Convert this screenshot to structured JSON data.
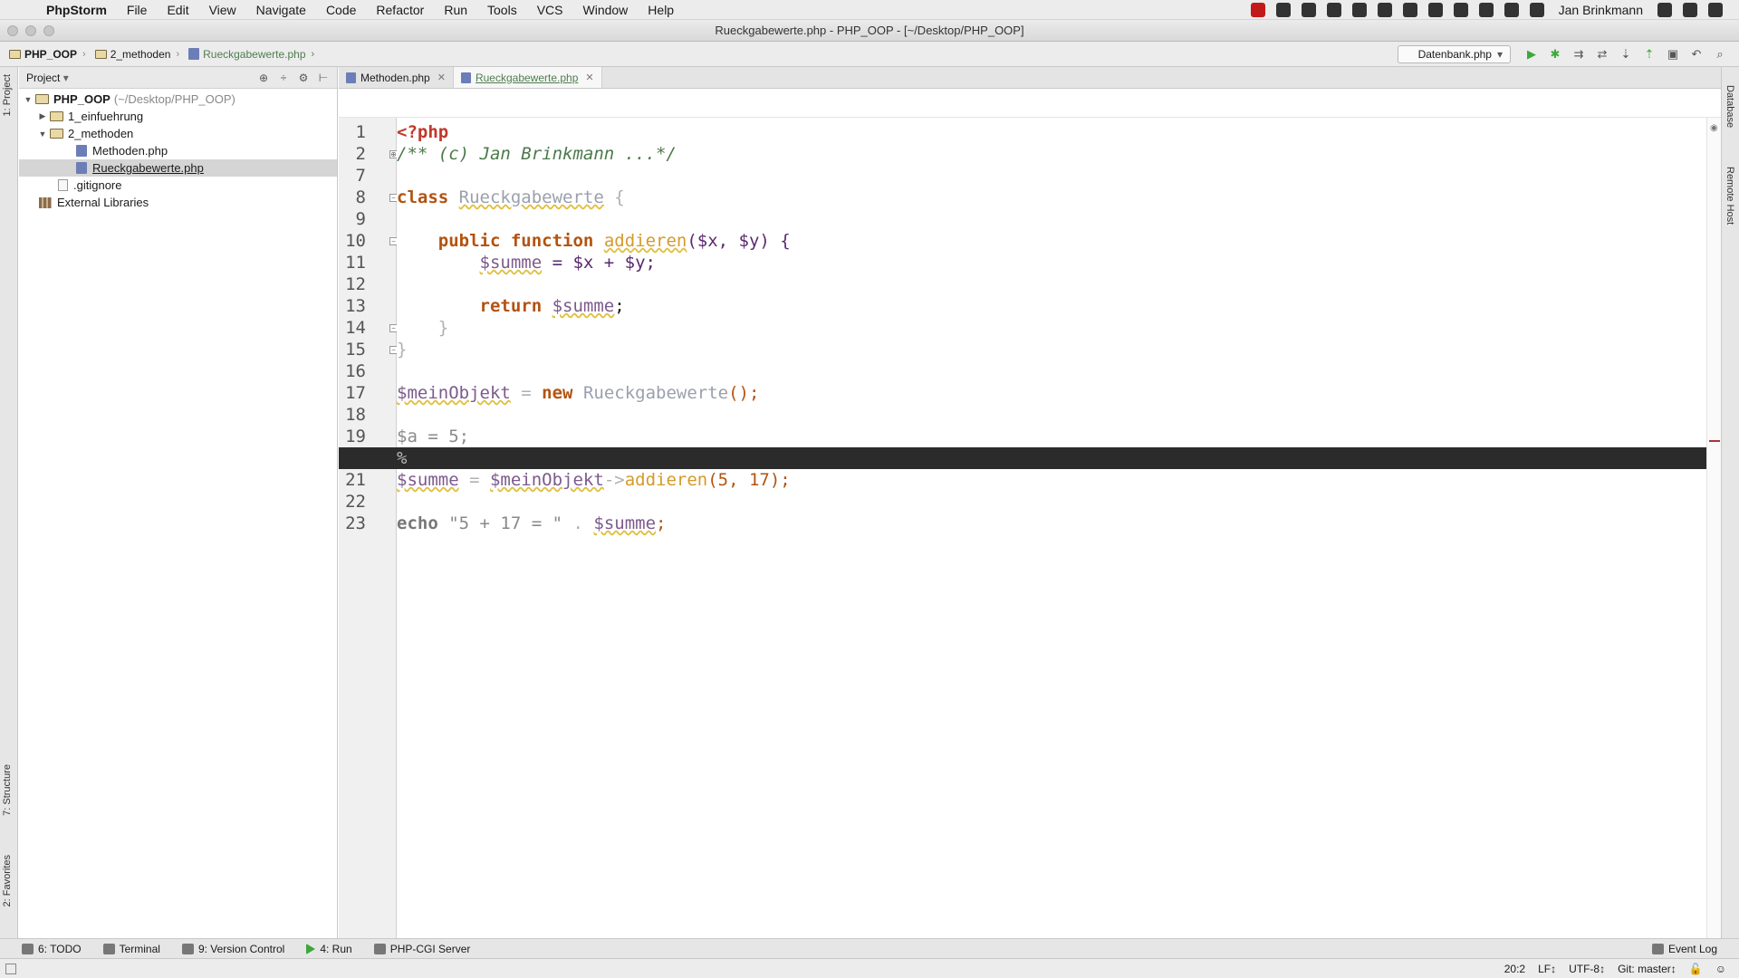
{
  "menubar": {
    "app_name": "PhpStorm",
    "items": [
      "File",
      "Edit",
      "View",
      "Navigate",
      "Code",
      "Refactor",
      "Run",
      "Tools",
      "VCS",
      "Window",
      "Help"
    ],
    "user": "Jan Brinkmann"
  },
  "window": {
    "title": "Rueckgabewerte.php - PHP_OOP - [~/Desktop/PHP_OOP]"
  },
  "breadcrumb": {
    "items": [
      "PHP_OOP",
      "2_methoden",
      "Rueckgabewerte.php"
    ]
  },
  "toolbar": {
    "run_config": "Datenbank.php"
  },
  "left_stripe": {
    "project_tab": "1: Project",
    "structure_tab": "7: Structure",
    "favorites_tab": "2: Favorites"
  },
  "right_stripe": {
    "database_tab": "Database",
    "remote_host_tab": "Remote Host"
  },
  "project_panel": {
    "title": "Project",
    "tree": [
      {
        "label": "PHP_OOP",
        "suffix": "(~/Desktop/PHP_OOP)"
      },
      {
        "label": "1_einfuehrung"
      },
      {
        "label": "2_methoden"
      },
      {
        "label": "Methoden.php"
      },
      {
        "label": "Rueckgabewerte.php"
      },
      {
        "label": ".gitignore"
      },
      {
        "label": "External Libraries"
      }
    ]
  },
  "editor": {
    "tabs": [
      {
        "label": "Methoden.php"
      },
      {
        "label": "Rueckgabewerte.php"
      }
    ],
    "line_numbers": [
      "1",
      "2",
      "7",
      "8",
      "9",
      "10",
      "11",
      "12",
      "13",
      "14",
      "15",
      "16",
      "17",
      "18",
      "19",
      "20",
      "21",
      "22",
      "23"
    ],
    "code": {
      "l1": "<?php",
      "l2": "/** (c) Jan Brinkmann ...*/",
      "l8_kw": "class",
      "l8_cls": "Rueckgabewerte",
      "l8_brace": "{",
      "l10_kw": "public function",
      "l10_fn": "addieren",
      "l10_params": "($x, $y) {",
      "l11_var": "$summe",
      "l11_rest": " = $x + $y;",
      "l13_kw": "return",
      "l13_var": "$summe",
      "l13_end": ";",
      "l14": "}",
      "l15": "}",
      "l17_var": "$meinObjekt",
      "l17_eq": " = ",
      "l17_kw": "new",
      "l17_cls": "Rueckgabewerte",
      "l17_end": "();",
      "l19": "$a = 5;",
      "l20": "%",
      "l21_var": "$summe",
      "l21_eq": " = ",
      "l21_obj": "$meinObjekt",
      "l21_arrow": "->",
      "l21_fn": "addieren",
      "l21_args": "(5, 17);",
      "l23_kw": "echo",
      "l23_str": "\"5 + 17 = \"",
      "l23_dot": " . ",
      "l23_var": "$summe",
      "l23_end": ";"
    }
  },
  "bottom_tools": {
    "todo": "6: TODO",
    "terminal": "Terminal",
    "vcs": "9: Version Control",
    "run": "4: Run",
    "server": "PHP-CGI Server",
    "event_log": "Event Log"
  },
  "status": {
    "position": "20:2",
    "line_sep": "LF↕",
    "encoding": "UTF-8↕",
    "git": "Git: master↕"
  }
}
